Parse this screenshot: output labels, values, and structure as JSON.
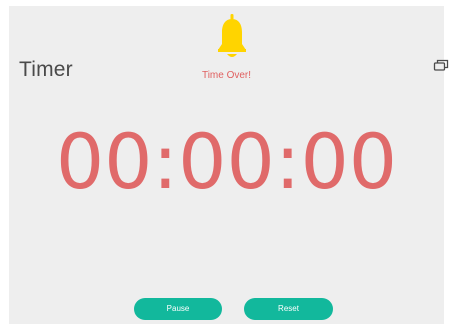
{
  "app": {
    "title": "Timer"
  },
  "alert": {
    "icon": "bell-icon",
    "message": "Time Over!",
    "icon_color": "#ffd400"
  },
  "timer": {
    "display": "00:00:00",
    "color": "#e06a6a"
  },
  "controls": {
    "pause_label": "Pause",
    "reset_label": "Reset",
    "button_color": "#12b89c"
  },
  "window": {
    "restore_icon": "restore-window-icon"
  }
}
